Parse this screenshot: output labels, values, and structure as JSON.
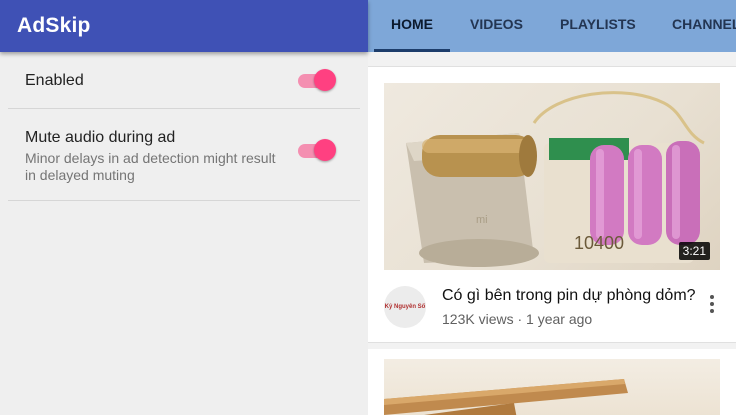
{
  "app": {
    "title": "AdSkip",
    "settings": [
      {
        "label": "Enabled",
        "enabled": true
      },
      {
        "label": "Mute audio during ad",
        "summary": "Minor delays in ad detection might result in delayed muting",
        "enabled": true
      }
    ],
    "colors": {
      "appbar": "#3f51b5",
      "toggle_thumb": "#ff4081",
      "toggle_track": "#f48fb1"
    }
  },
  "youtube": {
    "tabs": [
      {
        "label": "HOME",
        "active": true
      },
      {
        "label": "VIDEOS",
        "active": false
      },
      {
        "label": "PLAYLISTS",
        "active": false
      },
      {
        "label": "CHANNEL",
        "active": false
      }
    ],
    "video": {
      "title": "Có gì bên trong pin dự phòng dỏm?",
      "meta": "123K views · 1 year ago",
      "duration": "3:21",
      "channel_avatar_text": "Kỷ Nguyên Số",
      "capacity_marking": "10400",
      "brand_marking": "mi"
    },
    "icons": {
      "menu": "more-vert-icon"
    }
  }
}
